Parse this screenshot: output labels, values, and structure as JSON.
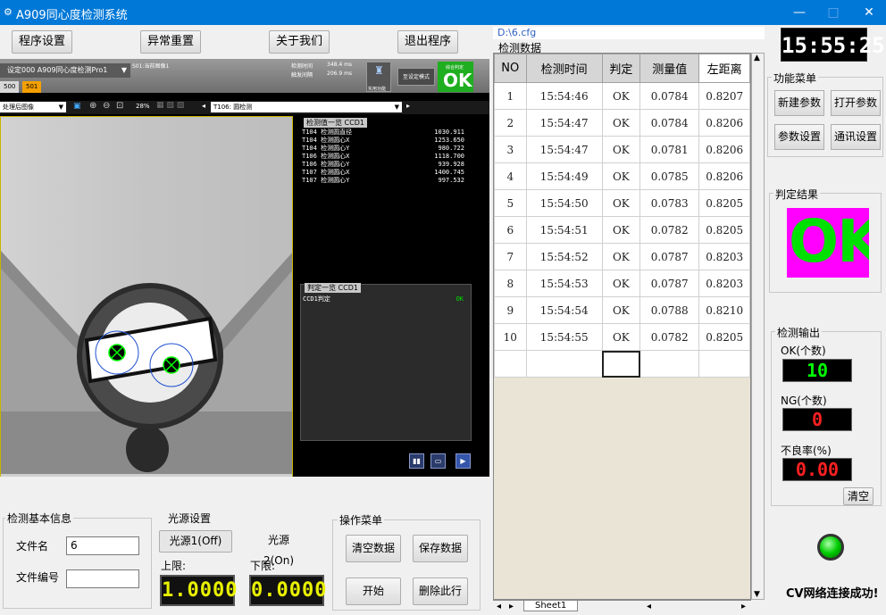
{
  "window": {
    "title": "A909同心度检测系统",
    "minimize": "—",
    "maximize": "□",
    "close": "✕"
  },
  "menu": {
    "program_settings": "程序设置",
    "reset": "异常重置",
    "about": "关于我们",
    "exit": "退出程序"
  },
  "config_path": "D:\\6.cfg",
  "clock": "15:55:25",
  "vision": {
    "setting_select": "设定000  A909同心度检测Pro1",
    "current_image": "S01:当前图像1",
    "detect_time_label": "检测时间",
    "detect_time_value": "348.4 ms",
    "trigger_label": "触发间隔",
    "trigger_value": "206.9 ms",
    "tool_label": "实用功能",
    "mode_button": "至设定模式",
    "total_label": "综合判定",
    "total_result": "OK",
    "tabs": [
      "500",
      "501"
    ],
    "image_select": "处理后图像",
    "zoom": "28%",
    "tool_select": "T106: 圆检测",
    "values_head": "检测值一览 CCD1",
    "values": [
      {
        "label": "T104 检测圆直径",
        "value": "1030.911"
      },
      {
        "label": "T104 检测圆心X",
        "value": "1253.650"
      },
      {
        "label": "T104 检测圆心Y",
        "value": "980.722"
      },
      {
        "label": "T106 检测圆心X",
        "value": "1118.700"
      },
      {
        "label": "T106 检测圆心Y",
        "value": "939.928"
      },
      {
        "label": "T107 检测圆心X",
        "value": "1400.745"
      },
      {
        "label": "T107 检测圆心Y",
        "value": "997.532"
      }
    ],
    "judge_head": "判定一览 CCD1",
    "judge_label": "CCD1判定",
    "judge_value": "OK"
  },
  "info": {
    "group": "检测基本信息",
    "file_name_label": "文件名",
    "file_name_value": "6",
    "file_no_label": "文件编号",
    "file_no_value": ""
  },
  "light": {
    "group": "光源设置",
    "source1": "光源1(Off)",
    "source2": "光源2(On)",
    "upper_label": "上限:",
    "upper_value": "1.0000",
    "lower_label": "下限:",
    "lower_value": "0.0000"
  },
  "ops": {
    "group": "操作菜单",
    "clear": "清空数据",
    "save": "保存数据",
    "start": "开始",
    "delete": "删除此行"
  },
  "table": {
    "group": "检测数据",
    "headers": [
      "NO",
      "检测时间",
      "判定",
      "测量值",
      "左距离"
    ],
    "rows": [
      [
        "1",
        "15:54:46",
        "OK",
        "0.0784",
        "0.8207"
      ],
      [
        "2",
        "15:54:47",
        "OK",
        "0.0784",
        "0.8206"
      ],
      [
        "3",
        "15:54:47",
        "OK",
        "0.0781",
        "0.8206"
      ],
      [
        "4",
        "15:54:49",
        "OK",
        "0.0785",
        "0.8206"
      ],
      [
        "5",
        "15:54:50",
        "OK",
        "0.0783",
        "0.8205"
      ],
      [
        "6",
        "15:54:51",
        "OK",
        "0.0782",
        "0.8205"
      ],
      [
        "7",
        "15:54:52",
        "OK",
        "0.0787",
        "0.8203"
      ],
      [
        "8",
        "15:54:53",
        "OK",
        "0.0787",
        "0.8203"
      ],
      [
        "9",
        "15:54:54",
        "OK",
        "0.0788",
        "0.8210"
      ],
      [
        "10",
        "15:54:55",
        "OK",
        "0.0782",
        "0.8205"
      ]
    ],
    "sheet": "Sheet1"
  },
  "func": {
    "group": "功能菜单",
    "new": "新建参数",
    "open": "打开参数",
    "settings": "参数设置",
    "comm": "通讯设置"
  },
  "result": {
    "group": "判定结果",
    "value": "OK"
  },
  "output": {
    "group": "检测输出",
    "ok_label": "OK(个数)",
    "ok_value": "10",
    "ng_label": "NG(个数)",
    "ng_value": "0",
    "rate_label": "不良率(%)",
    "rate_value": "0.00",
    "clear": "清空"
  },
  "network": "CV网络连接成功!",
  "colors": {
    "accent": "#0078d7",
    "ok_green": "#00e000",
    "led_yellow": "#e8f000",
    "led_red": "#ff2020"
  }
}
